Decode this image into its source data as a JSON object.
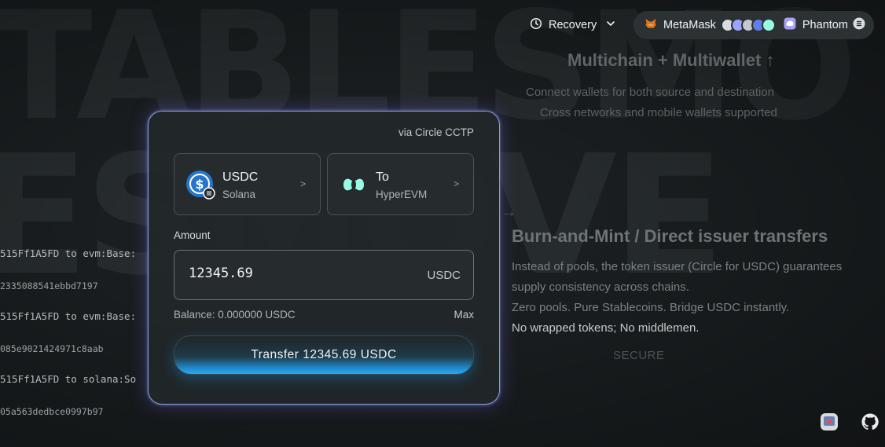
{
  "background": {
    "row1": "TABLESMO",
    "row2": "ESMOVE",
    "log_lines": [
      "515Ff1A5FD to evm:Base:",
      "2335088541ebbd7197",
      "515Ff1A5FD to evm:Base:",
      "085e9021424971c8aab",
      "515Ff1A5FD to solana:So",
      "05a563dedbce0997b97"
    ]
  },
  "header": {
    "recovery_label": "Recovery",
    "wallets": [
      {
        "name": "MetaMask",
        "icon": "metamask-fox-icon"
      },
      {
        "name": "Phantom",
        "icon": "phantom-ghost-icon"
      }
    ]
  },
  "info": {
    "title": "Multichain + Multiwallet ↑",
    "lines": [
      "Connect wallets for both source and destination",
      "Cross networks and mobile wallets supported"
    ],
    "burn_title": "Burn-and-Mint / Direct issuer transfers",
    "burn_lines": [
      "Instead of pools, the token issuer (Circle for USDC) guarantees",
      "supply consistency across chains.",
      "Zero pools. Pure Stablecoins. Bridge USDC instantly.",
      "No wrapped tokens; No middlemen."
    ],
    "secure_label": "SECURE",
    "arrow": "→"
  },
  "card": {
    "via": "via Circle CCTP",
    "from": {
      "token": "USDC",
      "network": "Solana",
      "caret": ">"
    },
    "to": {
      "label": "To",
      "network": "HyperEVM",
      "caret": ">"
    },
    "amount_label": "Amount",
    "amount_value": "12345.69",
    "amount_unit": "USDC",
    "balance": "Balance: 0.000000 USDC",
    "max_label": "Max",
    "transfer_label": "Transfer 12345.69 USDC"
  },
  "colors": {
    "accent": "#2da8f0",
    "card_border": "#8a9ee0",
    "usdc": "#2775ca",
    "hyperevm": "#97fce4"
  }
}
